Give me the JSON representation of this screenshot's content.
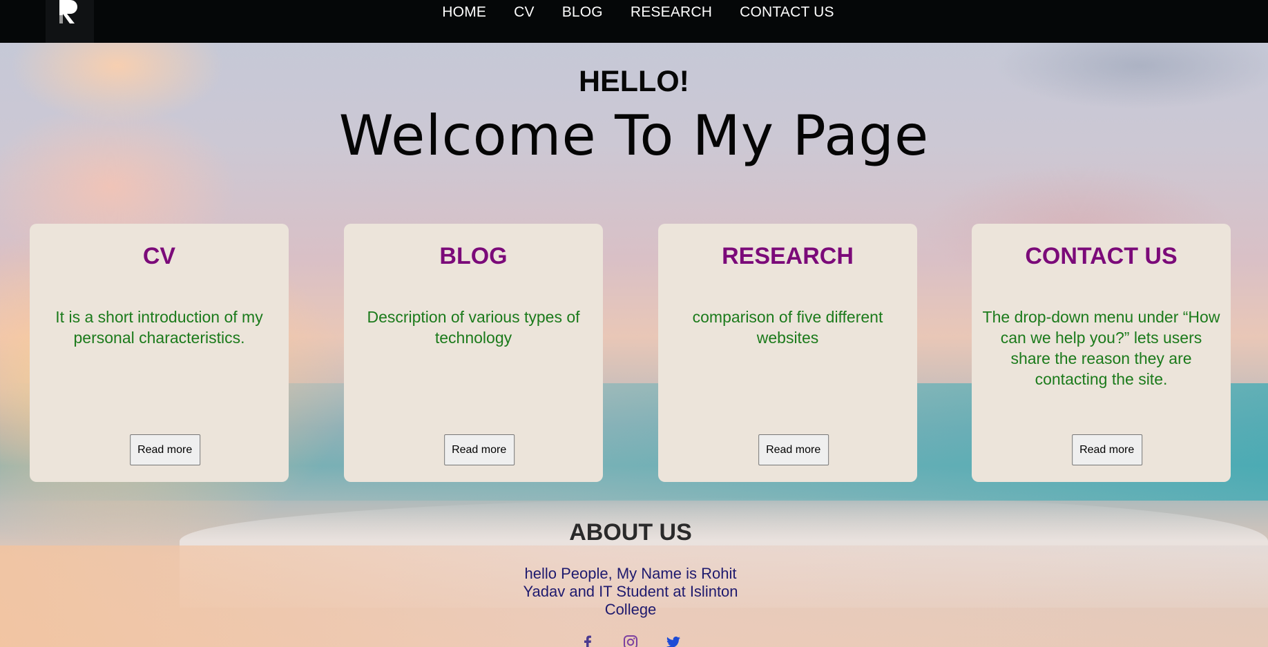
{
  "nav": {
    "logo_alt": "R",
    "links": [
      "HOME",
      "CV",
      "BLOG",
      "RESEARCH",
      "CONTACT US"
    ]
  },
  "hero": {
    "greeting": "HELLO!",
    "title": "Welcome To My Page"
  },
  "cards": [
    {
      "title": "CV",
      "description": "It is a short introduction of my personal characteristics.",
      "button": "Read more"
    },
    {
      "title": "BLOG",
      "description": "Description of various types of technology",
      "button": "Read more"
    },
    {
      "title": "RESEARCH",
      "description": "comparison of five different websites",
      "button": "Read more"
    },
    {
      "title": "CONTACT US",
      "description": "The drop-down menu under “How can we help you?” lets users share the reason they are contacting the site.",
      "button": "Read more"
    }
  ],
  "about": {
    "title": "ABOUT US",
    "text": "hello People, My Name is Rohit Yadav and IT Student at Islinton College"
  },
  "social": {
    "icons": [
      "facebook-icon",
      "instagram-icon",
      "twitter-icon"
    ],
    "colors": {
      "facebook": "#4b3a8f",
      "instagram": "#7c3fa0",
      "twitter": "#1d4bd6"
    }
  },
  "colors": {
    "navbar": "#050708",
    "card_bg": "#ece4da",
    "card_title": "#7b0a79",
    "card_text": "#1b7a1b"
  }
}
